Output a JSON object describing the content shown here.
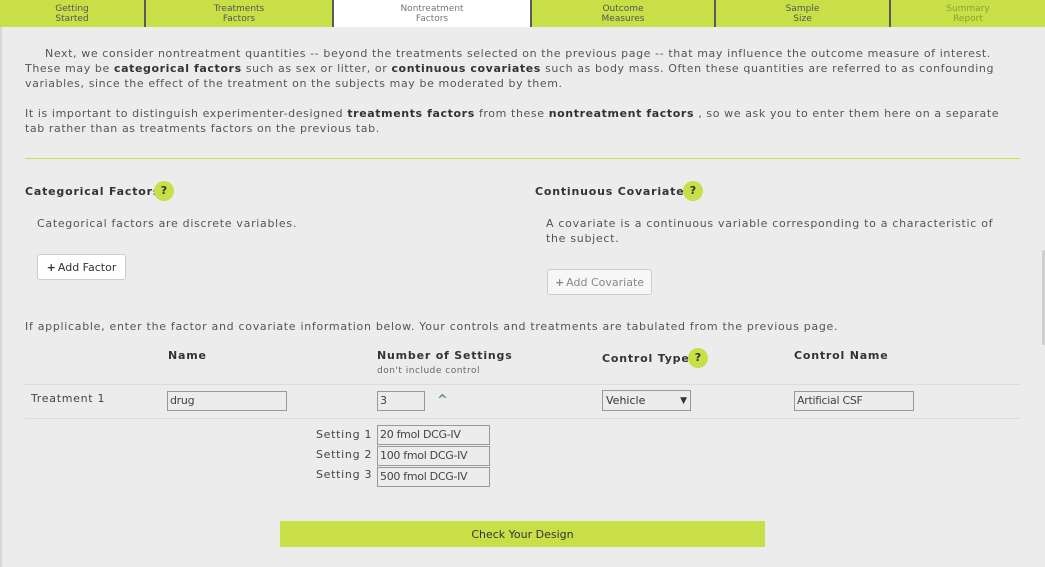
{
  "tabs": [
    {
      "label": "Getting\nStarted",
      "state": "done"
    },
    {
      "label": "Treatments\nFactors",
      "state": "done"
    },
    {
      "label": "Nontreatment\nFactors",
      "state": "active"
    },
    {
      "label": "Outcome\nMeasures",
      "state": "done"
    },
    {
      "label": "Sample\nSize",
      "state": "done"
    },
    {
      "label": "Summary\nReport",
      "state": "faded"
    }
  ],
  "intro": {
    "p1_a": "Next, we consider nontreatment quantities -- beyond the treatments selected on the previous page -- that may influence the outcome measure of interest. These may be ",
    "p1_b": "categorical factors",
    "p1_c": " such as sex or litter, or ",
    "p1_d": "continuous covariates",
    "p1_e": " such as body mass. Often these quantities are referred to as confounding variables, since the effect of the treatment on the subjects may be moderated by them.",
    "p2_a": "It is important to distinguish experimenter-designed ",
    "p2_b": "treatments factors",
    "p2_c": " from these ",
    "p2_d": "nontreatment factors",
    "p2_e": " , so we ask you to enter them here on a separate tab rather than as treatments factors on the previous tab."
  },
  "categorical": {
    "title": "Categorical Factors",
    "help": "?",
    "description": "Categorical factors are discrete variables.",
    "button_plus": "+",
    "button_label": "Add Factor"
  },
  "continuous": {
    "title": "Continuous Covariates",
    "help": "?",
    "description": "A covariate is a continuous variable corresponding to a characteristic of the subject.",
    "button_plus": "+",
    "button_label": "Add Covariate"
  },
  "instructions": "If applicable, enter the factor and covariate information below. Your controls and treatments are tabulated from the previous page.",
  "table": {
    "headers": {
      "name": "Name",
      "settings": "Number of Settings",
      "settings_sub": "don't include control",
      "control_type": "Control Type",
      "control_type_help": "?",
      "control_name": "Control Name"
    },
    "row": {
      "label": "Treatment 1",
      "name_value": "drug",
      "settings_value": "3",
      "collapse_icon": "^",
      "control_type_value": "Vehicle",
      "select_arrow": "▼",
      "control_name_value": "Artificial CSF"
    },
    "settings": [
      {
        "label": "Setting 1",
        "value": "20 fmol DCG-IV"
      },
      {
        "label": "Setting 2",
        "value": "100 fmol DCG-IV"
      },
      {
        "label": "Setting 3",
        "value": "500 fmol DCG-IV"
      }
    ]
  },
  "check_button": "Check Your Design",
  "colors": {
    "accent": "#c8df48",
    "background": "#ececec"
  }
}
